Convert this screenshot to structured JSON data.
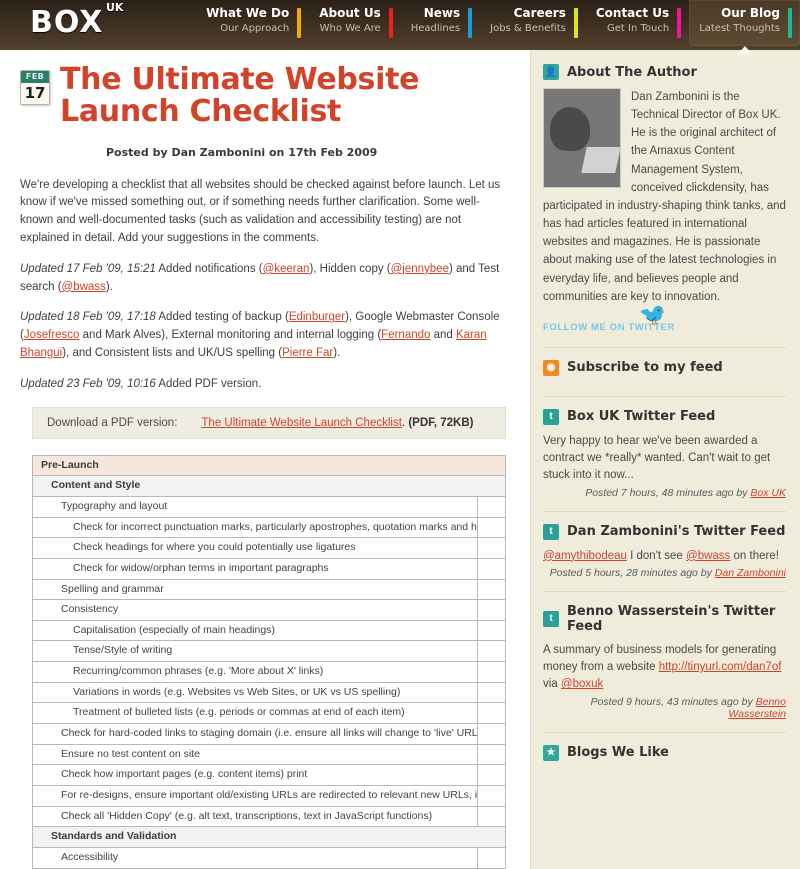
{
  "header": {
    "logo": {
      "text": "BOX",
      "sup": "UK"
    },
    "nav": [
      {
        "main": "What We Do",
        "sub": "Our Approach",
        "color": "#f5a800",
        "active": false
      },
      {
        "main": "About Us",
        "sub": "Who We Are",
        "color": "#e8221e",
        "active": false
      },
      {
        "main": "News",
        "sub": "Headlines",
        "color": "#1b9ad6",
        "active": false
      },
      {
        "main": "Careers",
        "sub": "Jobs & Benefits",
        "color": "#e2e21a",
        "active": false
      },
      {
        "main": "Contact Us",
        "sub": "Get In Touch",
        "color": "#f0179c",
        "active": false
      },
      {
        "main": "Our Blog",
        "sub": "Latest Thoughts",
        "color": "#19b99a",
        "active": true
      }
    ]
  },
  "post": {
    "date_month": "FEB",
    "date_day": "17",
    "title": "The Ultimate Website Launch Checklist",
    "byline": "Posted by Dan Zambonini on 17th Feb 2009",
    "intro": "We're developing a checklist that all websites should be checked against before launch. Let us know if we've missed something out, or if something needs further clarification. Some well-known and well-documented tasks (such as validation and accessibility testing) are not explained in detail. Add your suggestions in the comments.",
    "updates": [
      {
        "label": "Updated 17 Feb '09, 15:21",
        "parts": [
          {
            "t": " Added notifications ("
          },
          {
            "a": "@keeran"
          },
          {
            "t": "), Hidden copy ("
          },
          {
            "a": "@jennybee"
          },
          {
            "t": ") and Test search ("
          },
          {
            "a": "@bwass"
          },
          {
            "t": ")."
          }
        ]
      },
      {
        "label": "Updated 18 Feb '09, 17:18",
        "parts": [
          {
            "t": " Added testing of backup ("
          },
          {
            "a": "Edinburger"
          },
          {
            "t": "), Google Webmaster Console ("
          },
          {
            "a": "Josefresco"
          },
          {
            "t": " and Mark Alves), External monitoring and internal logging ("
          },
          {
            "a": "Fernando"
          },
          {
            "t": " and "
          },
          {
            "a": "Karan Bhangui"
          },
          {
            "t": "), and Consistent lists and UK/US spelling ("
          },
          {
            "a": "Pierre Far"
          },
          {
            "t": ")."
          }
        ]
      },
      {
        "label": "Updated 23 Feb '09, 10:16",
        "parts": [
          {
            "t": " Added PDF version."
          }
        ]
      }
    ]
  },
  "pdf": {
    "label": "Download a PDF version:",
    "link": "The Ultimate Website Launch Checklist",
    "suffix": ".",
    "meta": "(PDF, 72KB)"
  },
  "checklist": [
    {
      "level": 0,
      "text": "Pre-Launch",
      "mark": false
    },
    {
      "level": 1,
      "text": "Content and Style",
      "mark": false
    },
    {
      "level": 2,
      "text": "Typography and layout",
      "mark": true
    },
    {
      "level": 3,
      "text": "Check for incorrect punctuation marks, particularly apostrophes, quotation marks and hyphens/dashes",
      "mark": true
    },
    {
      "level": 3,
      "text": "Check headings for where you could potentially use ligatures",
      "mark": true
    },
    {
      "level": 3,
      "text": "Check for widow/orphan terms in important paragraphs",
      "mark": true
    },
    {
      "level": 2,
      "text": "Spelling and grammar",
      "mark": true
    },
    {
      "level": 2,
      "text": "Consistency",
      "mark": true
    },
    {
      "level": 3,
      "text": "Capitalisation (especially of main headings)",
      "mark": true
    },
    {
      "level": 3,
      "text": "Tense/Style of writing",
      "mark": true
    },
    {
      "level": 3,
      "text": "Recurring/common phrases (e.g. 'More about X' links)",
      "mark": true
    },
    {
      "level": 3,
      "text": "Variations in words (e.g. Websites vs Web Sites, or UK vs US spelling)",
      "mark": true
    },
    {
      "level": 3,
      "text": "Treatment of bulleted lists (e.g. periods or commas at end of each item)",
      "mark": true
    },
    {
      "level": 2,
      "text": "Check for hard-coded links to staging domain (i.e. ensure all links will change to 'live' URL/domain when site is launched)",
      "mark": true
    },
    {
      "level": 2,
      "text": "Ensure no test content on site",
      "mark": true
    },
    {
      "level": 2,
      "text": "Check how important pages (e.g. content items) print",
      "mark": true
    },
    {
      "level": 2,
      "text": "For re-designs, ensure important old/existing URLs are redirected to relevant new URLs, if the URL scheme is changing",
      "mark": true
    },
    {
      "level": 2,
      "text": "Check all 'Hidden Copy' (e.g. alt text, transcriptions, text in JavaScript functions)",
      "mark": true
    },
    {
      "level": 1,
      "text": "Standards and Validation",
      "mark": false
    },
    {
      "level": 2,
      "text": "Accessibility",
      "mark": true
    }
  ],
  "sidebar": {
    "author": {
      "icon": "user-icon",
      "title": "About The Author",
      "bio": "Dan Zambonini is the Technical Director of Box UK. He is the original architect of the Amaxus Content Management System, conceived clickdensity, has participated in industry-shaping think tanks, and has had articles featured in international websites and magazines. He is passionate about making use of the latest technologies in everyday life, and believes people and communities are key to innovation.",
      "follow": "FOLLOW ME ON TWITTER"
    },
    "subscribe": {
      "icon": "rss-icon",
      "title": "Subscribe to my feed"
    },
    "feeds": [
      {
        "icon": "twitter-icon",
        "title": "Box UK Twitter Feed",
        "body_parts": [
          {
            "t": "Very happy to hear we've been awarded a contract we *really* wanted. Can't wait to get stuck into it now..."
          }
        ],
        "meta_prefix": "Posted 7 hours, 48 minutes ago by ",
        "meta_link": "Box UK"
      },
      {
        "icon": "twitter-icon",
        "title": "Dan Zambonini's Twitter Feed",
        "body_parts": [
          {
            "a": "@amythibodeau"
          },
          {
            "t": " I don't see "
          },
          {
            "a": "@bwass"
          },
          {
            "t": " on there!"
          }
        ],
        "meta_prefix": "Posted 5 hours, 28 minutes ago by ",
        "meta_link": "Dan Zambonini"
      },
      {
        "icon": "twitter-icon",
        "title": "Benno Wasserstein's Twitter Feed",
        "body_parts": [
          {
            "t": "A summary of business models for generating money from a website "
          },
          {
            "a": "http://tinyurl.com/dan7of"
          },
          {
            "t": " via "
          },
          {
            "a": "@boxuk"
          }
        ],
        "meta_prefix": "Posted 9 hours, 43 minutes ago by ",
        "meta_link": "Benno Wasserstein"
      }
    ],
    "blogs": {
      "icon": "star-icon",
      "title": "Blogs We Like"
    }
  }
}
